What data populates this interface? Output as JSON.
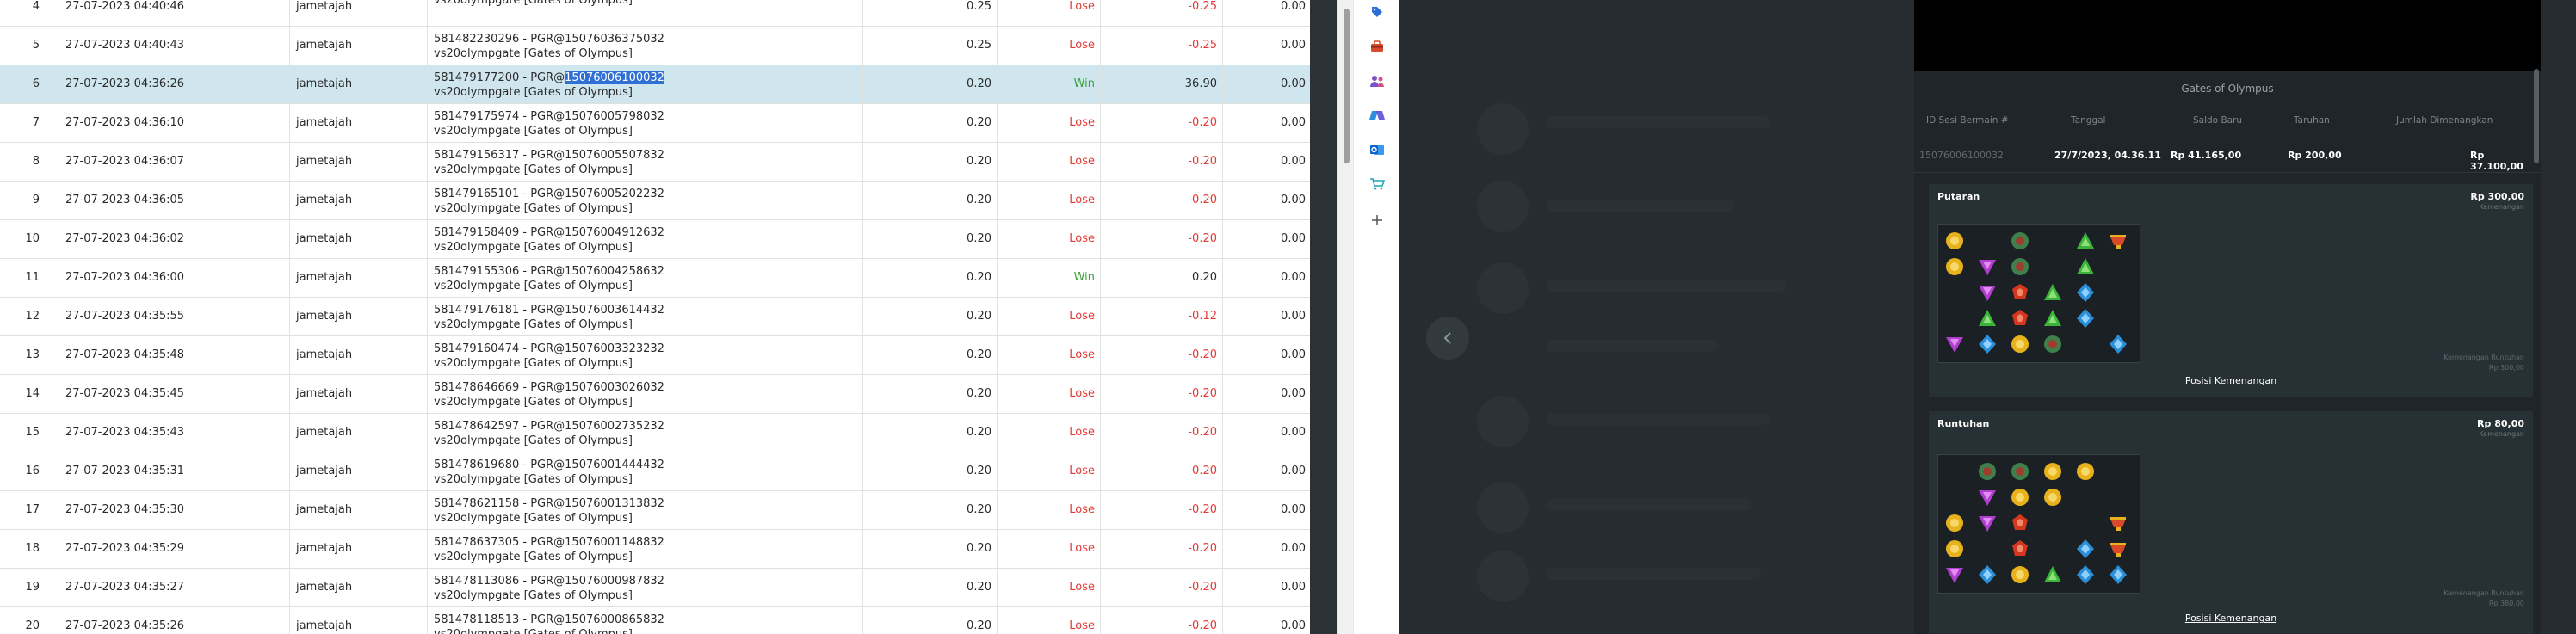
{
  "table": {
    "rows": [
      {
        "no": "4",
        "date": "27-07-2023 04:40:46",
        "user": "jametajah",
        "desc1": "",
        "desc2": "vs20olympgate [Gates of Olympus]",
        "bet": "0.25",
        "result": "Lose",
        "win": "-0.25",
        "balance": "0.00"
      },
      {
        "no": "5",
        "date": "27-07-2023 04:40:43",
        "user": "jametajah",
        "desc1": "581482230296 - PGR@15076036375032",
        "desc2": "vs20olympgate [Gates of Olympus]",
        "bet": "0.25",
        "result": "Lose",
        "win": "-0.25",
        "balance": "0.00"
      },
      {
        "no": "6",
        "date": "27-07-2023 04:36:26",
        "user": "jametajah",
        "desc1": "581479177200 - PGR@",
        "desc1_hl": "15076006100032",
        "desc2": "vs20olympgate [Gates of Olympus]",
        "bet": "0.20",
        "result": "Win",
        "win": "36.90",
        "balance": "0.00",
        "selected": true
      },
      {
        "no": "7",
        "date": "27-07-2023 04:36:10",
        "user": "jametajah",
        "desc1": "581479175974 - PGR@15076005798032",
        "desc2": "vs20olympgate [Gates of Olympus]",
        "bet": "0.20",
        "result": "Lose",
        "win": "-0.20",
        "balance": "0.00"
      },
      {
        "no": "8",
        "date": "27-07-2023 04:36:07",
        "user": "jametajah",
        "desc1": "581479156317 - PGR@15076005507832",
        "desc2": "vs20olympgate [Gates of Olympus]",
        "bet": "0.20",
        "result": "Lose",
        "win": "-0.20",
        "balance": "0.00"
      },
      {
        "no": "9",
        "date": "27-07-2023 04:36:05",
        "user": "jametajah",
        "desc1": "581479165101 - PGR@15076005202232",
        "desc2": "vs20olympgate [Gates of Olympus]",
        "bet": "0.20",
        "result": "Lose",
        "win": "-0.20",
        "balance": "0.00"
      },
      {
        "no": "10",
        "date": "27-07-2023 04:36:02",
        "user": "jametajah",
        "desc1": "581479158409 - PGR@15076004912632",
        "desc2": "vs20olympgate [Gates of Olympus]",
        "bet": "0.20",
        "result": "Lose",
        "win": "-0.20",
        "balance": "0.00"
      },
      {
        "no": "11",
        "date": "27-07-2023 04:36:00",
        "user": "jametajah",
        "desc1": "581479155306 - PGR@15076004258632",
        "desc2": "vs20olympgate [Gates of Olympus]",
        "bet": "0.20",
        "result": "Win",
        "win": "0.20",
        "balance": "0.00"
      },
      {
        "no": "12",
        "date": "27-07-2023 04:35:55",
        "user": "jametajah",
        "desc1": "581479176181 - PGR@15076003614432",
        "desc2": "vs20olympgate [Gates of Olympus]",
        "bet": "0.20",
        "result": "Lose",
        "win": "-0.12",
        "balance": "0.00"
      },
      {
        "no": "13",
        "date": "27-07-2023 04:35:48",
        "user": "jametajah",
        "desc1": "581479160474 - PGR@15076003323232",
        "desc2": "vs20olympgate [Gates of Olympus]",
        "bet": "0.20",
        "result": "Lose",
        "win": "-0.20",
        "balance": "0.00"
      },
      {
        "no": "14",
        "date": "27-07-2023 04:35:45",
        "user": "jametajah",
        "desc1": "581478646669 - PGR@15076003026032",
        "desc2": "vs20olympgate [Gates of Olympus]",
        "bet": "0.20",
        "result": "Lose",
        "win": "-0.20",
        "balance": "0.00"
      },
      {
        "no": "15",
        "date": "27-07-2023 04:35:43",
        "user": "jametajah",
        "desc1": "581478642597 - PGR@15076002735232",
        "desc2": "vs20olympgate [Gates of Olympus]",
        "bet": "0.20",
        "result": "Lose",
        "win": "-0.20",
        "balance": "0.00"
      },
      {
        "no": "16",
        "date": "27-07-2023 04:35:31",
        "user": "jametajah",
        "desc1": "581478619680 - PGR@15076001444432",
        "desc2": "vs20olympgate [Gates of Olympus]",
        "bet": "0.20",
        "result": "Lose",
        "win": "-0.20",
        "balance": "0.00"
      },
      {
        "no": "17",
        "date": "27-07-2023 04:35:30",
        "user": "jametajah",
        "desc1": "581478621158 - PGR@15076001313832",
        "desc2": "vs20olympgate [Gates of Olympus]",
        "bet": "0.20",
        "result": "Lose",
        "win": "-0.20",
        "balance": "0.00"
      },
      {
        "no": "18",
        "date": "27-07-2023 04:35:29",
        "user": "jametajah",
        "desc1": "581478637305 - PGR@15076001148832",
        "desc2": "vs20olympgate [Gates of Olympus]",
        "bet": "0.20",
        "result": "Lose",
        "win": "-0.20",
        "balance": "0.00"
      },
      {
        "no": "19",
        "date": "27-07-2023 04:35:27",
        "user": "jametajah",
        "desc1": "581478113086 - PGR@15076000987832",
        "desc2": "vs20olympgate [Gates of Olympus]",
        "bet": "0.20",
        "result": "Lose",
        "win": "-0.20",
        "balance": "0.00"
      },
      {
        "no": "20",
        "date": "27-07-2023 04:35:26",
        "user": "jametajah",
        "desc1": "581478118513 - PGR@15076000865832",
        "desc2": "vs20olympgate [Gates of Olympus]",
        "bet": "0.20",
        "result": "Lose",
        "win": "-0.20",
        "balance": "0.00"
      }
    ]
  },
  "sidebar_icons": [
    "tag-icon",
    "toolbox-icon",
    "users-icon",
    "copilot-icon",
    "outlook-icon",
    "cart-icon",
    "plus-icon"
  ],
  "panel": {
    "title": "Gates of Olympus",
    "headers": {
      "session": "ID Sesi Bermain #",
      "date": "Tanggal",
      "balance": "Saldo Baru",
      "bet": "Taruhan",
      "win": "Jumlah Dimenangkan"
    },
    "values": {
      "session": "15076006100032",
      "date": "27/7/2023, 04.36.11",
      "balance": "Rp 41.165,00",
      "bet": "Rp 200,00",
      "win": "Rp 37.100,00"
    },
    "cards": [
      {
        "title": "Putaran",
        "amount": "Rp 300,00",
        "sub": "Kemenangan",
        "small1": "Kemenangan Runtuhan",
        "small2": "Rp 300,00",
        "link": "Posisi Kemenangan"
      },
      {
        "title": "Runtuhan",
        "amount": "Rp 80,00",
        "sub": "Kemenangan",
        "small1": "Kemenangan Runtuhan",
        "small2": "Rp 380,00",
        "link": "Posisi Kemenangan"
      }
    ]
  },
  "colors": {
    "lose": "#e53935",
    "win": "#3aa23a",
    "selection": "#cfe6ee",
    "highlight": "#2f6fd6",
    "panel_bg": "#1f2528"
  }
}
